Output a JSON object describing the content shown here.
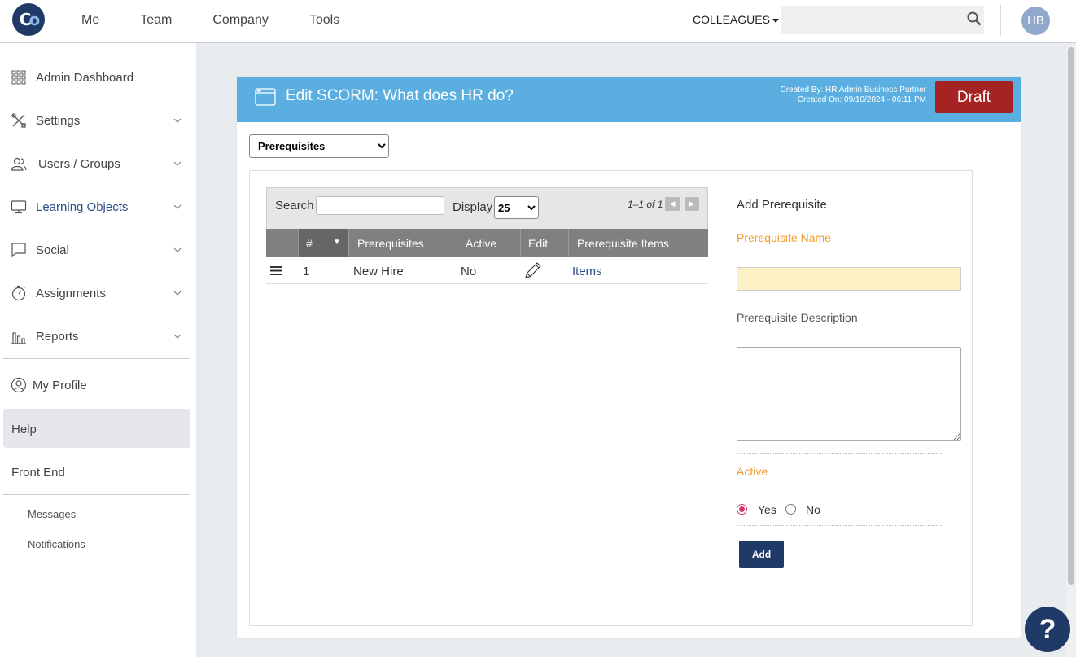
{
  "topnav": {
    "logo": "Co",
    "items": [
      "Me",
      "Team",
      "Company",
      "Tools"
    ],
    "colleagues_label": "COLLEAGUES",
    "search_placeholder": "",
    "avatar_initials": "HB"
  },
  "sidebar": {
    "items": [
      {
        "label": "Admin Dashboard",
        "icon": "grid-icon"
      },
      {
        "label": "Settings",
        "icon": "tools-icon"
      },
      {
        "label": "Users / Groups",
        "icon": "users-icon"
      },
      {
        "label": "Learning Objects",
        "icon": "monitor-icon"
      },
      {
        "label": "Social",
        "icon": "chat-icon"
      },
      {
        "label": "Assignments",
        "icon": "stopwatch-icon"
      },
      {
        "label": "Reports",
        "icon": "bar-chart-icon"
      }
    ],
    "my_profile": "My Profile",
    "help": "Help",
    "front_end": "Front End",
    "messages": "Messages",
    "notifications": "Notifications"
  },
  "panel": {
    "title": "Edit SCORM: What does HR do?",
    "created_by": "Created By: HR Admin Business Partner",
    "created_on": "Created On: 09/10/2024 - 06:11 PM",
    "status_button": "Draft",
    "section_select": "Prerequisites"
  },
  "grid": {
    "search_label": "Search",
    "display_label": "Display",
    "display_value": "25",
    "pager": "1–1 of 1",
    "columns": [
      "#",
      "Prerequisites",
      "Active",
      "Edit",
      "Prerequisite Items"
    ],
    "rows": [
      {
        "num": "1",
        "name": "New Hire",
        "active": "No",
        "items_link": "Items"
      }
    ]
  },
  "form": {
    "title": "Add Prerequisite",
    "name_label": "Prerequisite Name",
    "name_value": "",
    "desc_label": "Prerequisite Description",
    "desc_value": "",
    "active_label": "Active",
    "yes_label": "Yes",
    "no_label": "No",
    "selected": "Yes",
    "add_button": "Add"
  },
  "help_fab": "?",
  "colors": {
    "header_blue": "#5aafe0",
    "draft_red": "#a52322",
    "navy": "#1f3a66",
    "orange_label": "#f29a2e"
  }
}
